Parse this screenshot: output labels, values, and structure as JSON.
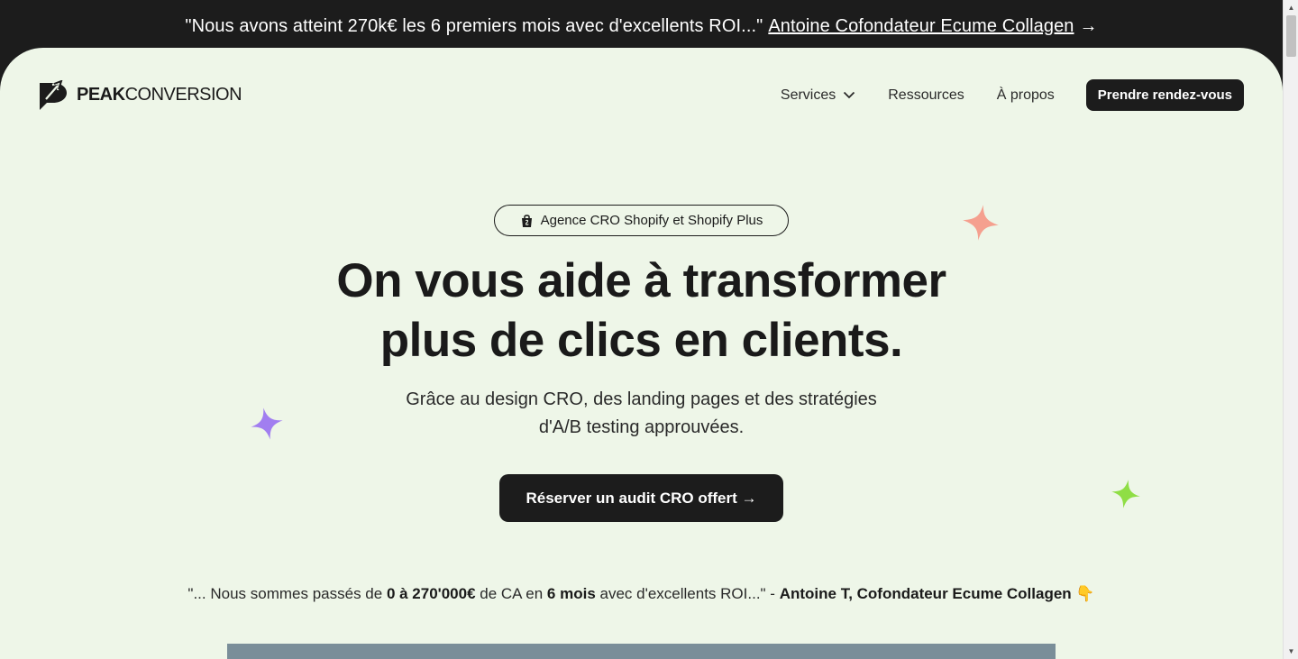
{
  "banner": {
    "quote": "\"Nous avons atteint 270k€ les 6 premiers mois avec d'excellents ROI...\"",
    "link_label": "Antoine Cofondateur Ecume Collagen",
    "arrow": "→"
  },
  "logo": {
    "strong": "PEAK",
    "light": "CONVERSION"
  },
  "nav": {
    "items": [
      {
        "label": "Services",
        "has_dropdown": true,
        "icon": "chevron-down-icon"
      },
      {
        "label": "Ressources"
      },
      {
        "label": "À propos"
      }
    ],
    "cta_label": "Prendre rendez-vous"
  },
  "hero": {
    "badge_label": "Agence CRO Shopify et Shopify Plus",
    "badge_icon": "shopping-bag-icon",
    "title_line1": "On vous aide à transformer",
    "title_line2": "plus de clics en clients.",
    "subtitle_line1": "Grâce au design CRO, des landing pages et des stratégies",
    "subtitle_line2": "d'A/B testing approuvées.",
    "cta_label": "Réserver un audit CRO offert →"
  },
  "testimonial": {
    "part1": "\"... Nous sommes passés de ",
    "bold1": "0 à 270'000€",
    "part2": " de CA en ",
    "bold2": "6 mois",
    "part3": " avec d'excellents ROI...\" - ",
    "author": "Antoine T, Cofondateur Ecume Collagen",
    "emoji": "👇"
  },
  "colors": {
    "background": "#eef6e8",
    "dark": "#1c1c1c",
    "sparkle_coral": "#f5a08f",
    "sparkle_purple": "#a17ef0",
    "sparkle_green": "#8fde45",
    "video_placeholder": "#7a8e99"
  }
}
